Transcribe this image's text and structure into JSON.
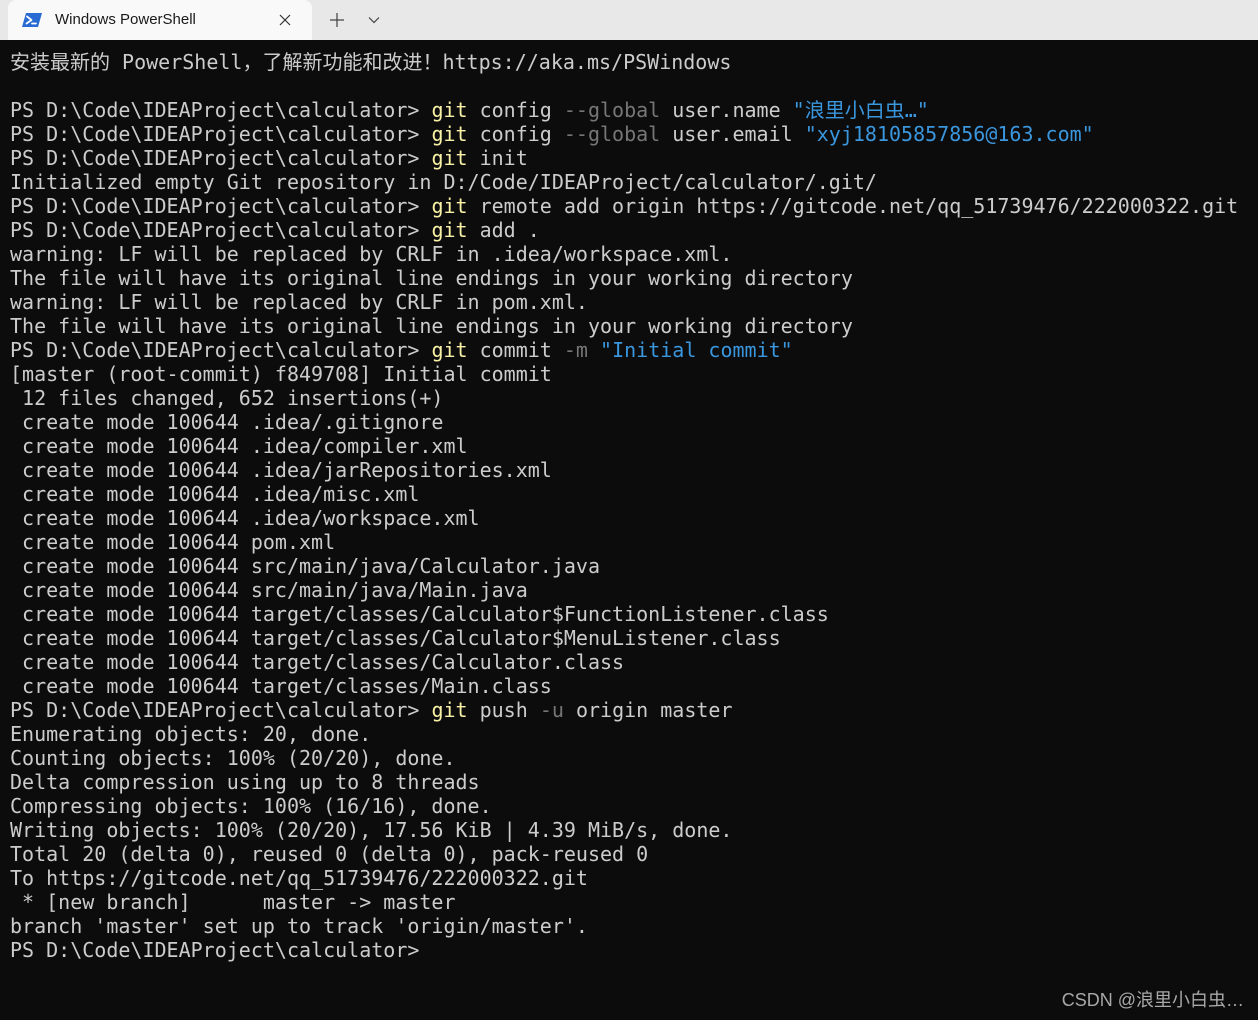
{
  "window": {
    "tab": {
      "title": "Windows PowerShell"
    },
    "icons": {
      "tab": "powershell-icon",
      "close": "close-icon",
      "new_tab": "plus-icon",
      "dropdown": "chevron-down-icon"
    },
    "colors": {
      "tab_bar": "#e8e8e8",
      "active_tab": "#f9f9f9",
      "tab_text": "#1a1a1a",
      "powershell_blue": "#2a6ad3"
    }
  },
  "terminal": {
    "colors": {
      "background": "#0c0c0c",
      "foreground": "#cccccc",
      "command": "#f9f1a5",
      "string": "#3a96dd",
      "parameter": "#767676"
    },
    "lines": [
      [
        {
          "text": "安装最新的 PowerShell，了解新功能和改进！https://aka.ms/PSWindows"
        }
      ],
      [],
      [
        {
          "text": "PS D:\\Code\\IDEAProject\\calculator> "
        },
        {
          "text": "git",
          "color": "#f9f1a5"
        },
        {
          "text": " config "
        },
        {
          "text": "--global",
          "color": "#767676"
        },
        {
          "text": " user.name "
        },
        {
          "text": "\"浪里小白虫…\"",
          "color": "#3a96dd"
        }
      ],
      [
        {
          "text": "PS D:\\Code\\IDEAProject\\calculator> "
        },
        {
          "text": "git",
          "color": "#f9f1a5"
        },
        {
          "text": " config "
        },
        {
          "text": "--global",
          "color": "#767676"
        },
        {
          "text": " user.email "
        },
        {
          "text": "\"xyj18105857856@163.com\"",
          "color": "#3a96dd"
        }
      ],
      [
        {
          "text": "PS D:\\Code\\IDEAProject\\calculator> "
        },
        {
          "text": "git",
          "color": "#f9f1a5"
        },
        {
          "text": " init"
        }
      ],
      [
        {
          "text": "Initialized empty Git repository in D:/Code/IDEAProject/calculator/.git/"
        }
      ],
      [
        {
          "text": "PS D:\\Code\\IDEAProject\\calculator> "
        },
        {
          "text": "git",
          "color": "#f9f1a5"
        },
        {
          "text": " remote add origin https://gitcode.net/qq_51739476/222000322.git"
        }
      ],
      [
        {
          "text": "PS D:\\Code\\IDEAProject\\calculator> "
        },
        {
          "text": "git",
          "color": "#f9f1a5"
        },
        {
          "text": " add ."
        }
      ],
      [
        {
          "text": "warning: LF will be replaced by CRLF in .idea/workspace.xml."
        }
      ],
      [
        {
          "text": "The file will have its original line endings in your working directory"
        }
      ],
      [
        {
          "text": "warning: LF will be replaced by CRLF in pom.xml."
        }
      ],
      [
        {
          "text": "The file will have its original line endings in your working directory"
        }
      ],
      [
        {
          "text": "PS D:\\Code\\IDEAProject\\calculator> "
        },
        {
          "text": "git",
          "color": "#f9f1a5"
        },
        {
          "text": " commit "
        },
        {
          "text": "-m",
          "color": "#767676"
        },
        {
          "text": " "
        },
        {
          "text": "\"Initial commit\"",
          "color": "#3a96dd"
        }
      ],
      [
        {
          "text": "[master (root-commit) f849708] Initial commit"
        }
      ],
      [
        {
          "text": " 12 files changed, 652 insertions(+)"
        }
      ],
      [
        {
          "text": " create mode 100644 .idea/.gitignore"
        }
      ],
      [
        {
          "text": " create mode 100644 .idea/compiler.xml"
        }
      ],
      [
        {
          "text": " create mode 100644 .idea/jarRepositories.xml"
        }
      ],
      [
        {
          "text": " create mode 100644 .idea/misc.xml"
        }
      ],
      [
        {
          "text": " create mode 100644 .idea/workspace.xml"
        }
      ],
      [
        {
          "text": " create mode 100644 pom.xml"
        }
      ],
      [
        {
          "text": " create mode 100644 src/main/java/Calculator.java"
        }
      ],
      [
        {
          "text": " create mode 100644 src/main/java/Main.java"
        }
      ],
      [
        {
          "text": " create mode 100644 target/classes/Calculator$FunctionListener.class"
        }
      ],
      [
        {
          "text": " create mode 100644 target/classes/Calculator$MenuListener.class"
        }
      ],
      [
        {
          "text": " create mode 100644 target/classes/Calculator.class"
        }
      ],
      [
        {
          "text": " create mode 100644 target/classes/Main.class"
        }
      ],
      [
        {
          "text": "PS D:\\Code\\IDEAProject\\calculator> "
        },
        {
          "text": "git",
          "color": "#f9f1a5"
        },
        {
          "text": " push "
        },
        {
          "text": "-u",
          "color": "#767676"
        },
        {
          "text": " origin master"
        }
      ],
      [
        {
          "text": "Enumerating objects: 20, done."
        }
      ],
      [
        {
          "text": "Counting objects: 100% (20/20), done."
        }
      ],
      [
        {
          "text": "Delta compression using up to 8 threads"
        }
      ],
      [
        {
          "text": "Compressing objects: 100% (16/16), done."
        }
      ],
      [
        {
          "text": "Writing objects: 100% (20/20), 17.56 KiB | 4.39 MiB/s, done."
        }
      ],
      [
        {
          "text": "Total 20 (delta 0), reused 0 (delta 0), pack-reused 0"
        }
      ],
      [
        {
          "text": "To https://gitcode.net/qq_51739476/222000322.git"
        }
      ],
      [
        {
          "text": " * [new branch]      master -> master"
        }
      ],
      [
        {
          "text": "branch 'master' set up to track 'origin/master'."
        }
      ],
      [
        {
          "text": "PS D:\\Code\\IDEAProject\\calculator>"
        }
      ]
    ]
  },
  "watermark": {
    "text": "CSDN @浪里小白虫…",
    "color": "#a8a8a8"
  }
}
